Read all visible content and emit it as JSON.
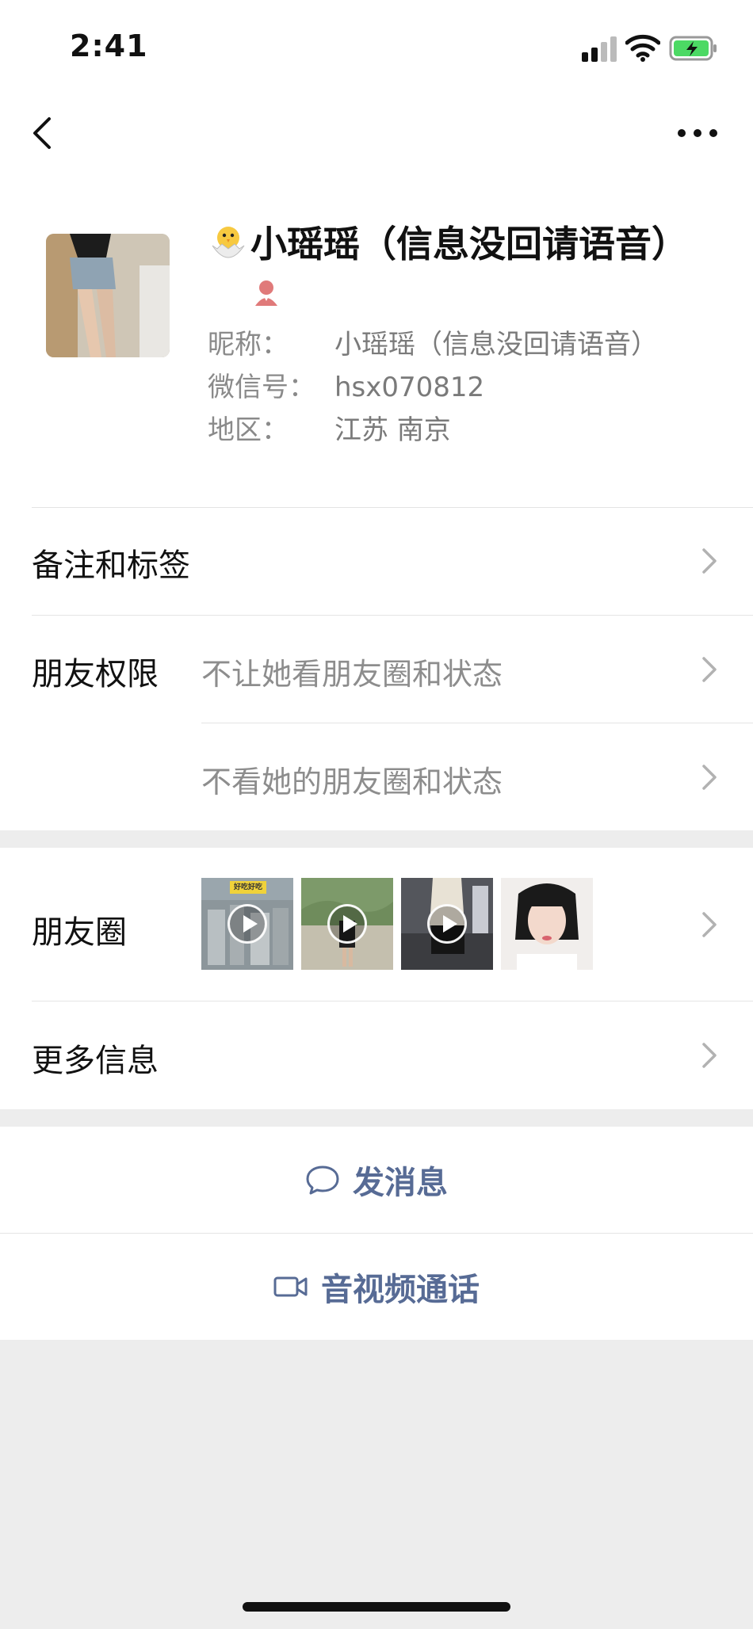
{
  "status_bar": {
    "time": "2:41"
  },
  "profile": {
    "display_name": "小瑶瑶（信息没回请语音）",
    "fields": [
      {
        "label": "昵称：",
        "value": "小瑶瑶（信息没回请语音）"
      },
      {
        "label": "微信号：",
        "value": "hsx070812"
      },
      {
        "label": "地区：",
        "value": "江苏 南京"
      }
    ]
  },
  "rows": {
    "remarks_label": "备注和标签",
    "permissions_label": "朋友权限",
    "permission_option_1": "不让她看朋友圈和状态",
    "permission_option_2": "不看她的朋友圈和状态",
    "moments_label": "朋友圈",
    "moments_thumb_caption": "好吃好吃",
    "more_info_label": "更多信息"
  },
  "actions": {
    "send_message": "发消息",
    "video_call": "音视频通话"
  },
  "colors": {
    "link_blue": "#576b95",
    "background_gray": "#ededed",
    "female_badge": "#e07a7a",
    "battery_green": "#4cd964"
  }
}
